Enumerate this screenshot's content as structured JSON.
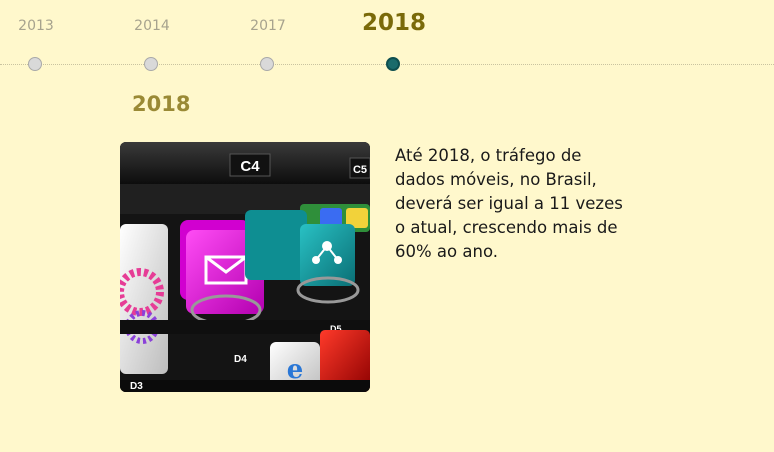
{
  "timeline": {
    "years": [
      {
        "label": "2013",
        "active": false
      },
      {
        "label": "2014",
        "active": false
      },
      {
        "label": "2017",
        "active": false
      },
      {
        "label": "2018",
        "active": true
      }
    ]
  },
  "content": {
    "title": "2018",
    "description": "Até 2018, o tráfego de dados móveis, no Brasil, deverá ser igual a 11 vezes o atual, crescendo mais de 60% ao ano.",
    "image_labels": {
      "top": "C4",
      "top_right": "C5",
      "mid_right": "D5",
      "bottom_mid": "D4",
      "bottom_left": "D3"
    }
  },
  "colors": {
    "background": "#fff8cc",
    "active_year": "#7a6a09",
    "inactive_year": "#a7a38e",
    "active_dot": "#1a6b6b",
    "title": "#9a8a35"
  }
}
